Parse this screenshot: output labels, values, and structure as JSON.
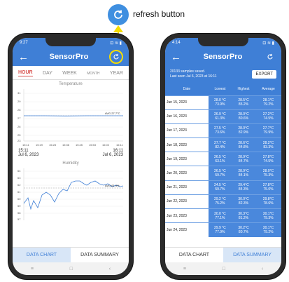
{
  "callout": {
    "label": "refresh button"
  },
  "left_phone": {
    "status": {
      "time": "9:27",
      "icons": "⊡ ≋ ▮"
    },
    "app_title": "SensorPro",
    "tabs": [
      {
        "label": "HOUR",
        "active": true
      },
      {
        "label": "DAY",
        "active": false
      },
      {
        "label": "WEEK",
        "active": false
      },
      {
        "label": "MONTH",
        "active": false
      },
      {
        "label": "YEAR",
        "active": false
      }
    ],
    "temperature": {
      "title": "Temperature",
      "avg_label": "AVG 27.7°C",
      "y_ticks": [
        "31",
        "29",
        "28",
        "27",
        "26",
        "25",
        "23"
      ],
      "x_ticks": [
        "15:11",
        "15:19",
        "15:28",
        "15:36",
        "15:45",
        "15:53",
        "16:02",
        "16:11"
      ]
    },
    "range": {
      "start_time": "15:11",
      "start_date": "Jul 6, 2023",
      "end_time": "16:11",
      "end_date": "Jul 6, 2023"
    },
    "humidity": {
      "title": "Humidity",
      "avg_label": "AVG 61.9%",
      "y_ticks": [
        "64",
        "63",
        "62",
        "61",
        "60",
        "59",
        "58",
        "57"
      ]
    },
    "bottom_tabs": {
      "chart": "DATA CHART",
      "summary": "DATA SUMMARY"
    },
    "nav": {
      "menu": "≡",
      "home": "□",
      "back": "‹"
    }
  },
  "right_phone": {
    "status": {
      "time": "4:14",
      "icons": "⊡ ≋ ▮"
    },
    "app_title": "SensorPro",
    "summary_line1": "20133 samples saved.",
    "summary_line2": "Last seen Jul 6, 2023 at 16:11",
    "export_label": "EXPORT",
    "columns": [
      "Date",
      "Lowest",
      "Highest",
      "Average"
    ],
    "rows": [
      {
        "date": "Jun 15, 2023",
        "low_t": "28.0 °C",
        "low_h": "73.9%",
        "high_t": "28.5°C",
        "high_h": "85.2%",
        "avg_t": "28.1°C",
        "avg_h": "79.2%"
      },
      {
        "date": "Jun 16, 2023",
        "low_t": "26.9 °C",
        "low_h": "61.3%",
        "high_t": "28.0°C",
        "high_h": "80.6%",
        "avg_t": "27.2°C",
        "avg_h": "74.5%"
      },
      {
        "date": "Jun 17, 2023",
        "low_t": "27.5 °C",
        "low_h": "73.6%",
        "high_t": "28.0°C",
        "high_h": "82.9%",
        "avg_t": "27.7°C",
        "avg_h": "79.9%"
      },
      {
        "date": "Jun 18, 2023",
        "low_t": "27.7 °C",
        "low_h": "82.4%",
        "high_t": "28.6°C",
        "high_h": "84.8%",
        "avg_t": "28.2°C",
        "avg_h": "83.3%"
      },
      {
        "date": "Jun 19, 2023",
        "low_t": "26.5 °C",
        "low_h": "63.1%",
        "high_t": "28.9°C",
        "high_h": "84.7%",
        "avg_t": "27.8°C",
        "avg_h": "74.5%"
      },
      {
        "date": "Jun 20, 2023",
        "low_t": "26.5 °C",
        "low_h": "59.7%",
        "high_t": "28.9°C",
        "high_h": "84.1%",
        "avg_t": "28.0°C",
        "avg_h": "75.3%"
      },
      {
        "date": "Jun 21, 2023",
        "low_t": "24.5 °C",
        "low_h": "59.7%",
        "high_t": "29.4°C",
        "high_h": "84.3%",
        "avg_t": "27.8°C",
        "avg_h": "75.0%"
      },
      {
        "date": "Jun 22, 2023",
        "low_t": "29.2 °C",
        "low_h": "75.2%",
        "high_t": "30.0°C",
        "high_h": "82.3%",
        "avg_t": "29.8°C",
        "avg_h": "78.6%"
      },
      {
        "date": "Jun 23, 2023",
        "low_t": "30.0 °C",
        "low_h": "77.1%",
        "high_t": "30.3°C",
        "high_h": "81.2%",
        "avg_t": "30.1°C",
        "avg_h": "79.3%"
      },
      {
        "date": "Jun 24, 2023",
        "low_t": "29.9 °C",
        "low_h": "77.9%",
        "high_t": "30.2°C",
        "high_h": "80.7%",
        "avg_t": "30.1°C",
        "avg_h": "79.2%"
      }
    ],
    "bottom_tabs": {
      "chart": "DATA CHART",
      "summary": "DATA SUMMARY"
    },
    "nav": {
      "menu": "≡",
      "home": "□",
      "back": "‹"
    }
  },
  "colors": {
    "primary": "#3f7fd6",
    "highlight": "#f5dd00",
    "active_tab": "#d9534f"
  }
}
